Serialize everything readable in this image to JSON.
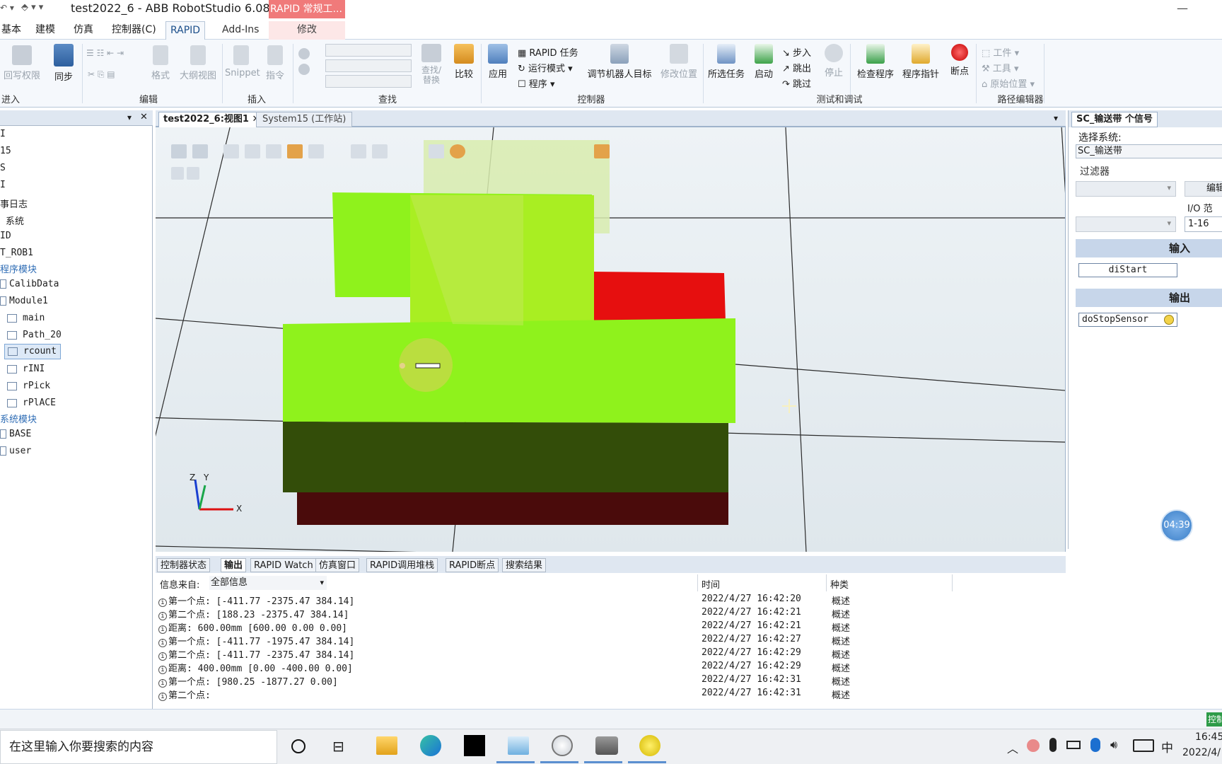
{
  "window": {
    "title": "test2022_6 - ABB RobotStudio 6.08",
    "context_tab": "RAPID 常规工...",
    "context_sub": "修改",
    "minimize": "—"
  },
  "ribbon_tabs": [
    "基本",
    "建模",
    "仿真",
    "控制器(C)",
    "RAPID",
    "Add-Ins"
  ],
  "ribbon": {
    "groups": [
      "进入",
      "编辑",
      "插入",
      "查找",
      "控制器",
      "测试和调试",
      "路径编辑器"
    ],
    "buttons": {
      "write_access": "回写权限",
      "sync": "同步",
      "format": "格式",
      "outline": "大纲视图",
      "snippet": "Snippet",
      "instruction": "指令",
      "find_replace": "查找/替换",
      "compare": "比较",
      "apply": "应用",
      "rapid_task": "RAPID 任务",
      "run_mode": "运行模式",
      "program": "程序",
      "adjust_targets": "调节机器人目标",
      "modify_position": "修改位置",
      "selected_tasks": "所选任务",
      "start": "启动",
      "step_in": "步入",
      "step_out": "跳出",
      "step_over": "跳过",
      "stop": "停止",
      "check_program": "检查程序",
      "program_pointer": "程序指针",
      "breakpoint": "断点",
      "workobject": "工件",
      "tool": "工具",
      "home_position": "原始位置"
    }
  },
  "tree": {
    "items": [
      "I",
      "15",
      "S",
      "I",
      "事日志",
      "系统",
      "ID",
      "T_ROB1",
      "程序模块",
      "CalibData",
      "Module1",
      "main",
      "Path_20",
      "rcount",
      "rINI",
      "rPick",
      "rPlACE",
      "系统模块",
      "BASE",
      "user"
    ]
  },
  "doc_tabs": [
    "test2022_6:视图1",
    "System15 (工作站)"
  ],
  "viewport": {
    "timer": "04:39",
    "axis_x": "X",
    "axis_y": "Y",
    "axis_z": "Z"
  },
  "signals": {
    "tab": "SC_输送带 个信号",
    "select_system_label": "选择系统:",
    "system_value": "SC_输送带",
    "filter_label": "过滤器",
    "edit_button": "编辑",
    "io_range_label": "I/O 范",
    "range_value": "1-16",
    "input_header": "输入",
    "inputs": [
      "diStart"
    ],
    "output_header": "输出",
    "outputs": [
      "doStopSensor"
    ]
  },
  "output_tabs": [
    "控制器状态",
    "输出",
    "RAPID Watch",
    "仿真窗口",
    "RAPID调用堆栈",
    "RAPID断点",
    "搜索结果"
  ],
  "output": {
    "source_label": "信息来自:",
    "source_value": "全部信息",
    "col_time": "时间",
    "col_type": "种类",
    "rows": [
      {
        "msg": "第一个点: [-411.77 -2375.47 384.14]",
        "time": "2022/4/27 16:42:20",
        "type": "概述"
      },
      {
        "msg": "第二个点: [188.23 -2375.47 384.14]",
        "time": "2022/4/27 16:42:21",
        "type": "概述"
      },
      {
        "msg": "距离: 600.00mm [600.00 0.00 0.00]",
        "time": "2022/4/27 16:42:21",
        "type": "概述"
      },
      {
        "msg": "第一个点: [-411.77 -1975.47 384.14]",
        "time": "2022/4/27 16:42:27",
        "type": "概述"
      },
      {
        "msg": "第二个点: [-411.77 -2375.47 384.14]",
        "time": "2022/4/27 16:42:29",
        "type": "概述"
      },
      {
        "msg": "距离: 400.00mm [0.00 -400.00 0.00]",
        "time": "2022/4/27 16:42:29",
        "type": "概述"
      },
      {
        "msg": "第一个点: [980.25 -1877.27 0.00]",
        "time": "2022/4/27 16:42:31",
        "type": "概述"
      },
      {
        "msg": "第二个点:",
        "time": "2022/4/27 16:42:31",
        "type": "概述"
      }
    ]
  },
  "status": {
    "right_badge": "控制"
  },
  "taskbar": {
    "search_placeholder": "在这里输入你要搜索的内容",
    "ime": "中",
    "time": "16:45",
    "date": "2022/4/"
  }
}
